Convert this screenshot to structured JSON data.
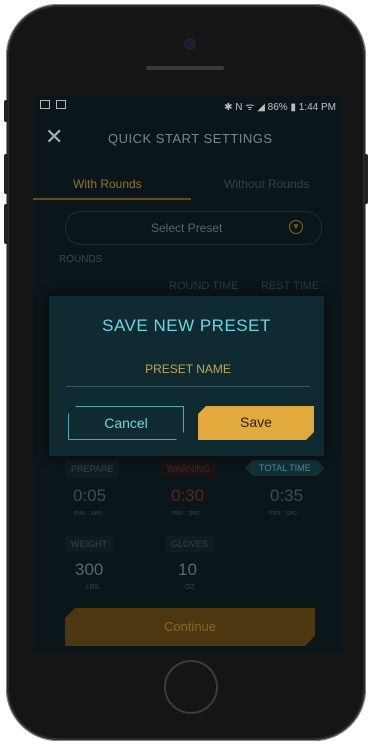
{
  "status": {
    "left_icons": [
      "image-icon",
      "sim-icon"
    ],
    "right_text": "✱ N ᯤ ◢ 86% ▮ 1:44 PM"
  },
  "header": {
    "title": "QUICK START SETTINGS",
    "close_icon": "close-icon"
  },
  "tabs": [
    {
      "label": "With Rounds",
      "active": true
    },
    {
      "label": "Without Rounds",
      "active": false
    }
  ],
  "preset": {
    "label": "Select Preset"
  },
  "section": {
    "rounds": "ROUNDS",
    "round_time": "ROUND TIME",
    "rest_time": "REST TIME"
  },
  "dialog": {
    "title": "SAVE NEW PRESET",
    "input_placeholder": "PRESET NAME",
    "cancel_label": "Cancel",
    "save_label": "Save"
  },
  "stats": {
    "prepare": {
      "label": "PREPARE",
      "value": "0:05",
      "unit": "min : sec"
    },
    "warning": {
      "label": "WARNING",
      "value": "0:30",
      "unit": "min : sec"
    },
    "total": {
      "label": "TOTAL TIME",
      "value": "0:35",
      "unit": "min : sec"
    },
    "weight": {
      "label": "WEIGHT",
      "value": "300",
      "unit": "LBS"
    },
    "gloves": {
      "label": "GLOVES",
      "value": "10",
      "unit": "OZ"
    }
  },
  "continue_label": "Continue",
  "colors": {
    "accent_gold": "#e2aa3c",
    "accent_cyan": "#69d6e3",
    "bg": "#0e1c20"
  }
}
